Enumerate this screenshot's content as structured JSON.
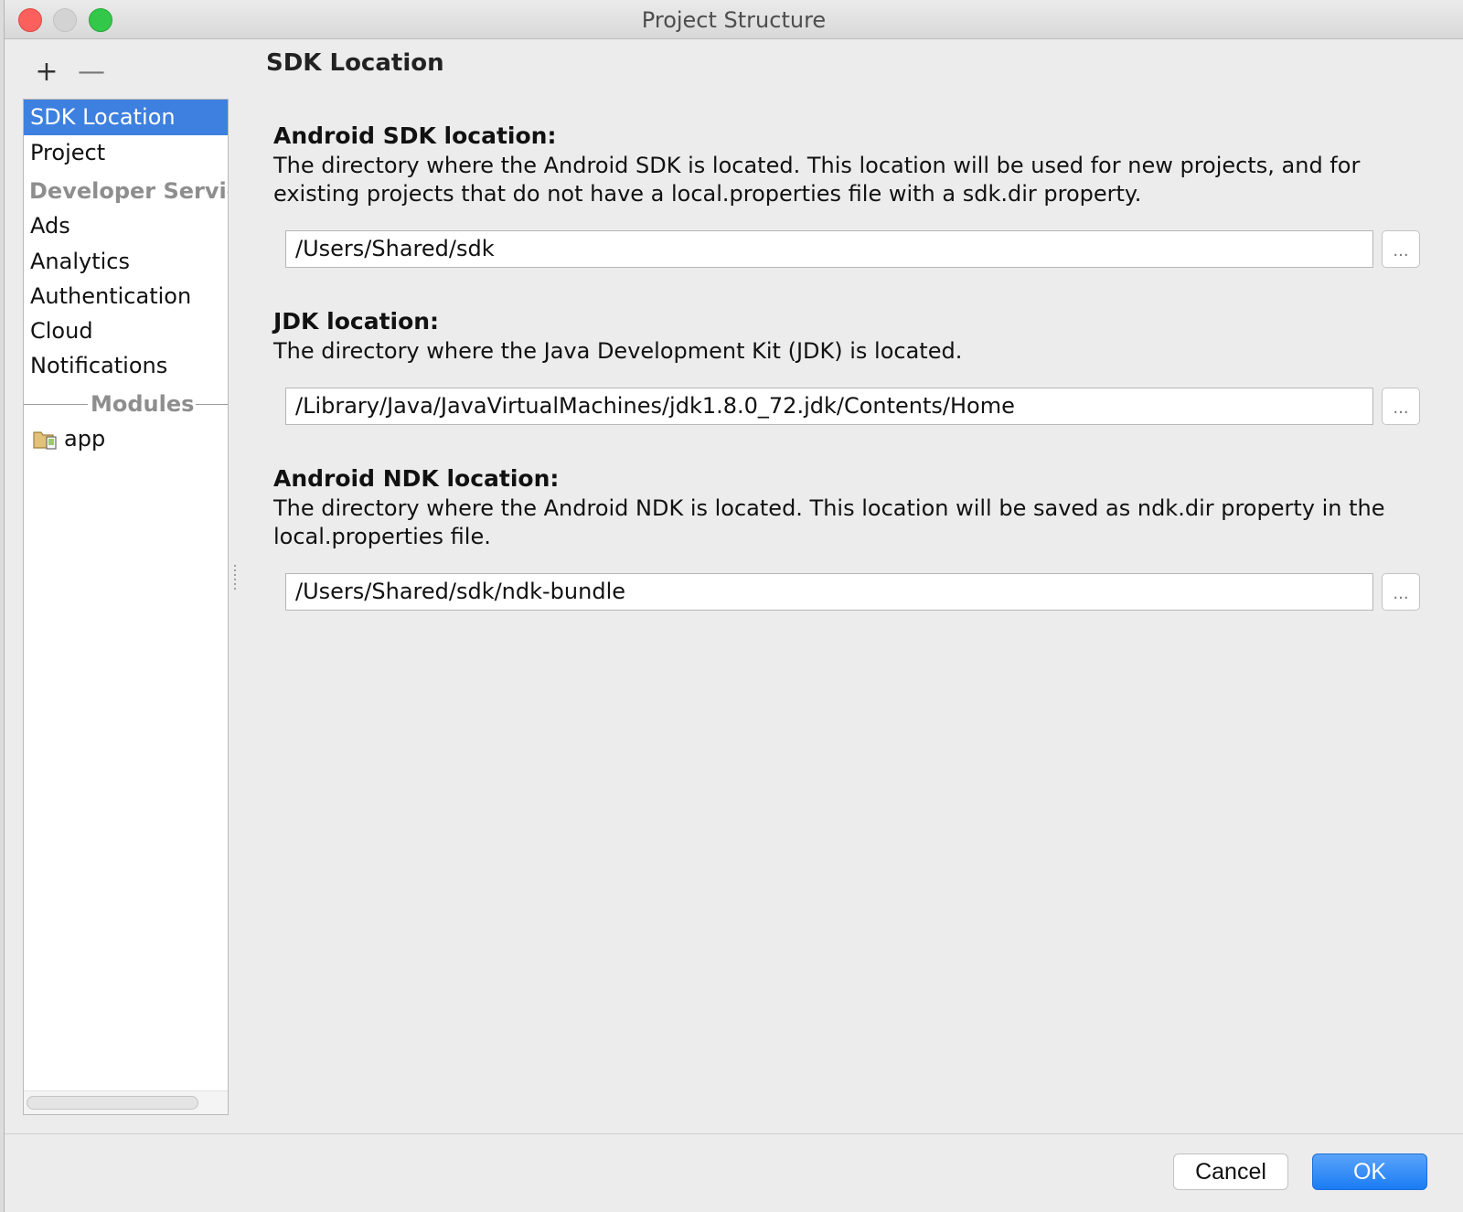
{
  "window": {
    "title": "Project Structure"
  },
  "toolbar": {
    "add_icon": "+",
    "remove_icon": "—"
  },
  "sidebar": {
    "items": [
      {
        "label": "SDK Location",
        "selected": true
      },
      {
        "label": "Project"
      }
    ],
    "group_heading": "Developer Servic",
    "service_items": [
      {
        "label": "Ads"
      },
      {
        "label": "Analytics"
      },
      {
        "label": "Authentication"
      },
      {
        "label": "Cloud"
      },
      {
        "label": "Notifications"
      }
    ],
    "modules_label": "Modules",
    "modules": [
      {
        "label": "app",
        "icon": "module-folder-icon"
      }
    ]
  },
  "panel": {
    "title": "SDK Location",
    "sections": [
      {
        "heading": "Android SDK location:",
        "description": "The directory where the Android SDK is located. This location will be used for new projects, and for existing projects that do not have a local.properties file with a sdk.dir property.",
        "value": "/Users/Shared/sdk",
        "browse_label": "..."
      },
      {
        "heading": "JDK location:",
        "description": "The directory where the Java Development Kit (JDK) is located.",
        "value": "/Library/Java/JavaVirtualMachines/jdk1.8.0_72.jdk/Contents/Home",
        "browse_label": "..."
      },
      {
        "heading": "Android NDK location:",
        "description": "The directory where the Android NDK is located. This location will be saved as ndk.dir property in the local.properties file.",
        "value": "/Users/Shared/sdk/ndk-bundle",
        "browse_label": "..."
      }
    ]
  },
  "footer": {
    "cancel_label": "Cancel",
    "ok_label": "OK"
  },
  "colors": {
    "selection": "#3d80df",
    "ok_button": "#1b7cf4"
  }
}
